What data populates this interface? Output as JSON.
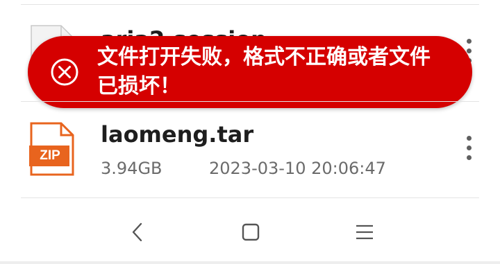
{
  "files": [
    {
      "name": "aria2.session",
      "icon": "blank-file-icon"
    },
    {
      "name": "laomeng.tar",
      "size": "3.94GB",
      "modified": "2023-03-10 20:06:47",
      "icon": "zip-file-icon",
      "badge": "ZIP"
    }
  ],
  "toast": {
    "message": "文件打开失败，格式不正确或者文件已损坏！",
    "icon": "error-x-icon",
    "color": "#d50000"
  },
  "navbar": {
    "back_icon": "back-chevron-icon",
    "home_icon": "home-square-icon",
    "menu_icon": "menu-lines-icon"
  },
  "colors": {
    "zip_orange": "#e8641e",
    "error_red": "#d50000"
  }
}
